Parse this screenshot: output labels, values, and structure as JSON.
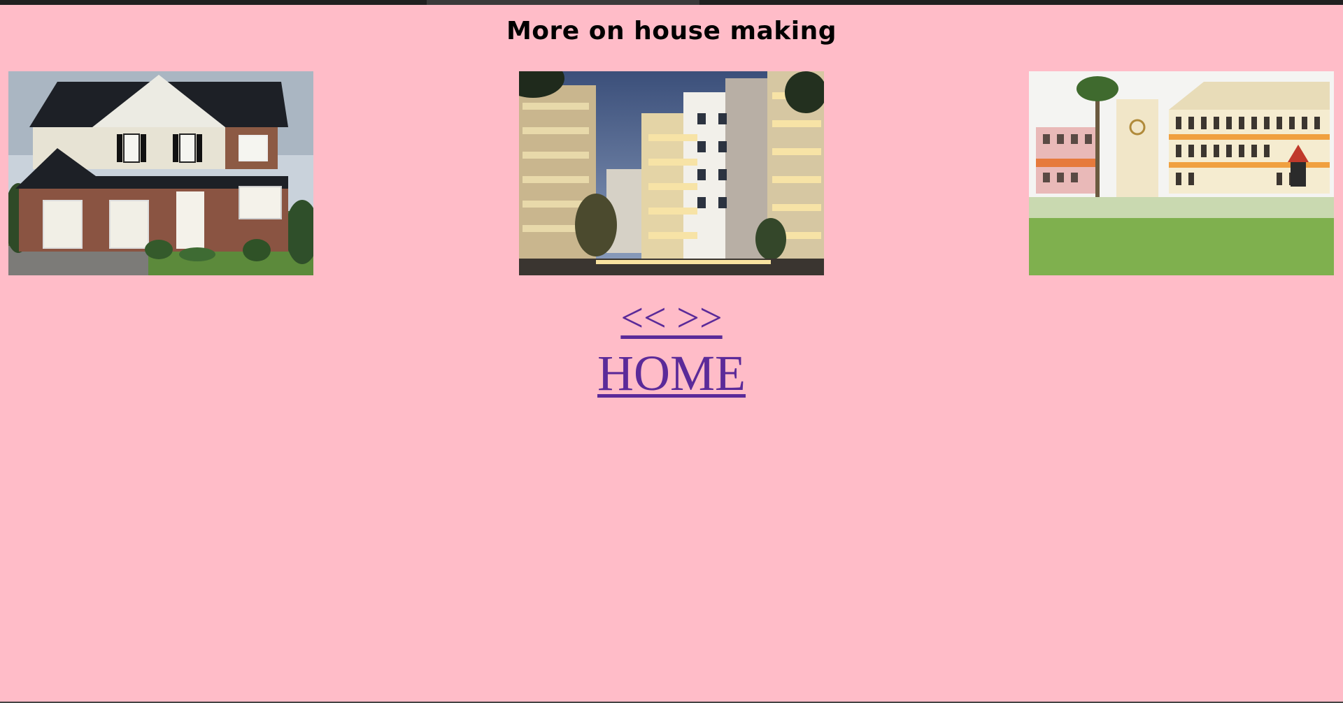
{
  "page": {
    "title": "More on house making",
    "background_color": "#ffbcc8",
    "link_color": "#5b2a99"
  },
  "images": [
    {
      "name": "house-photo",
      "depicts": "two-storey suburban brick house"
    },
    {
      "name": "apartment-photo",
      "depicts": "modern apartment complex at dusk"
    },
    {
      "name": "school-building-photo",
      "depicts": "institution building with lawn"
    }
  ],
  "nav": {
    "arrows_label": "<< >>",
    "home_label": "HOME"
  }
}
